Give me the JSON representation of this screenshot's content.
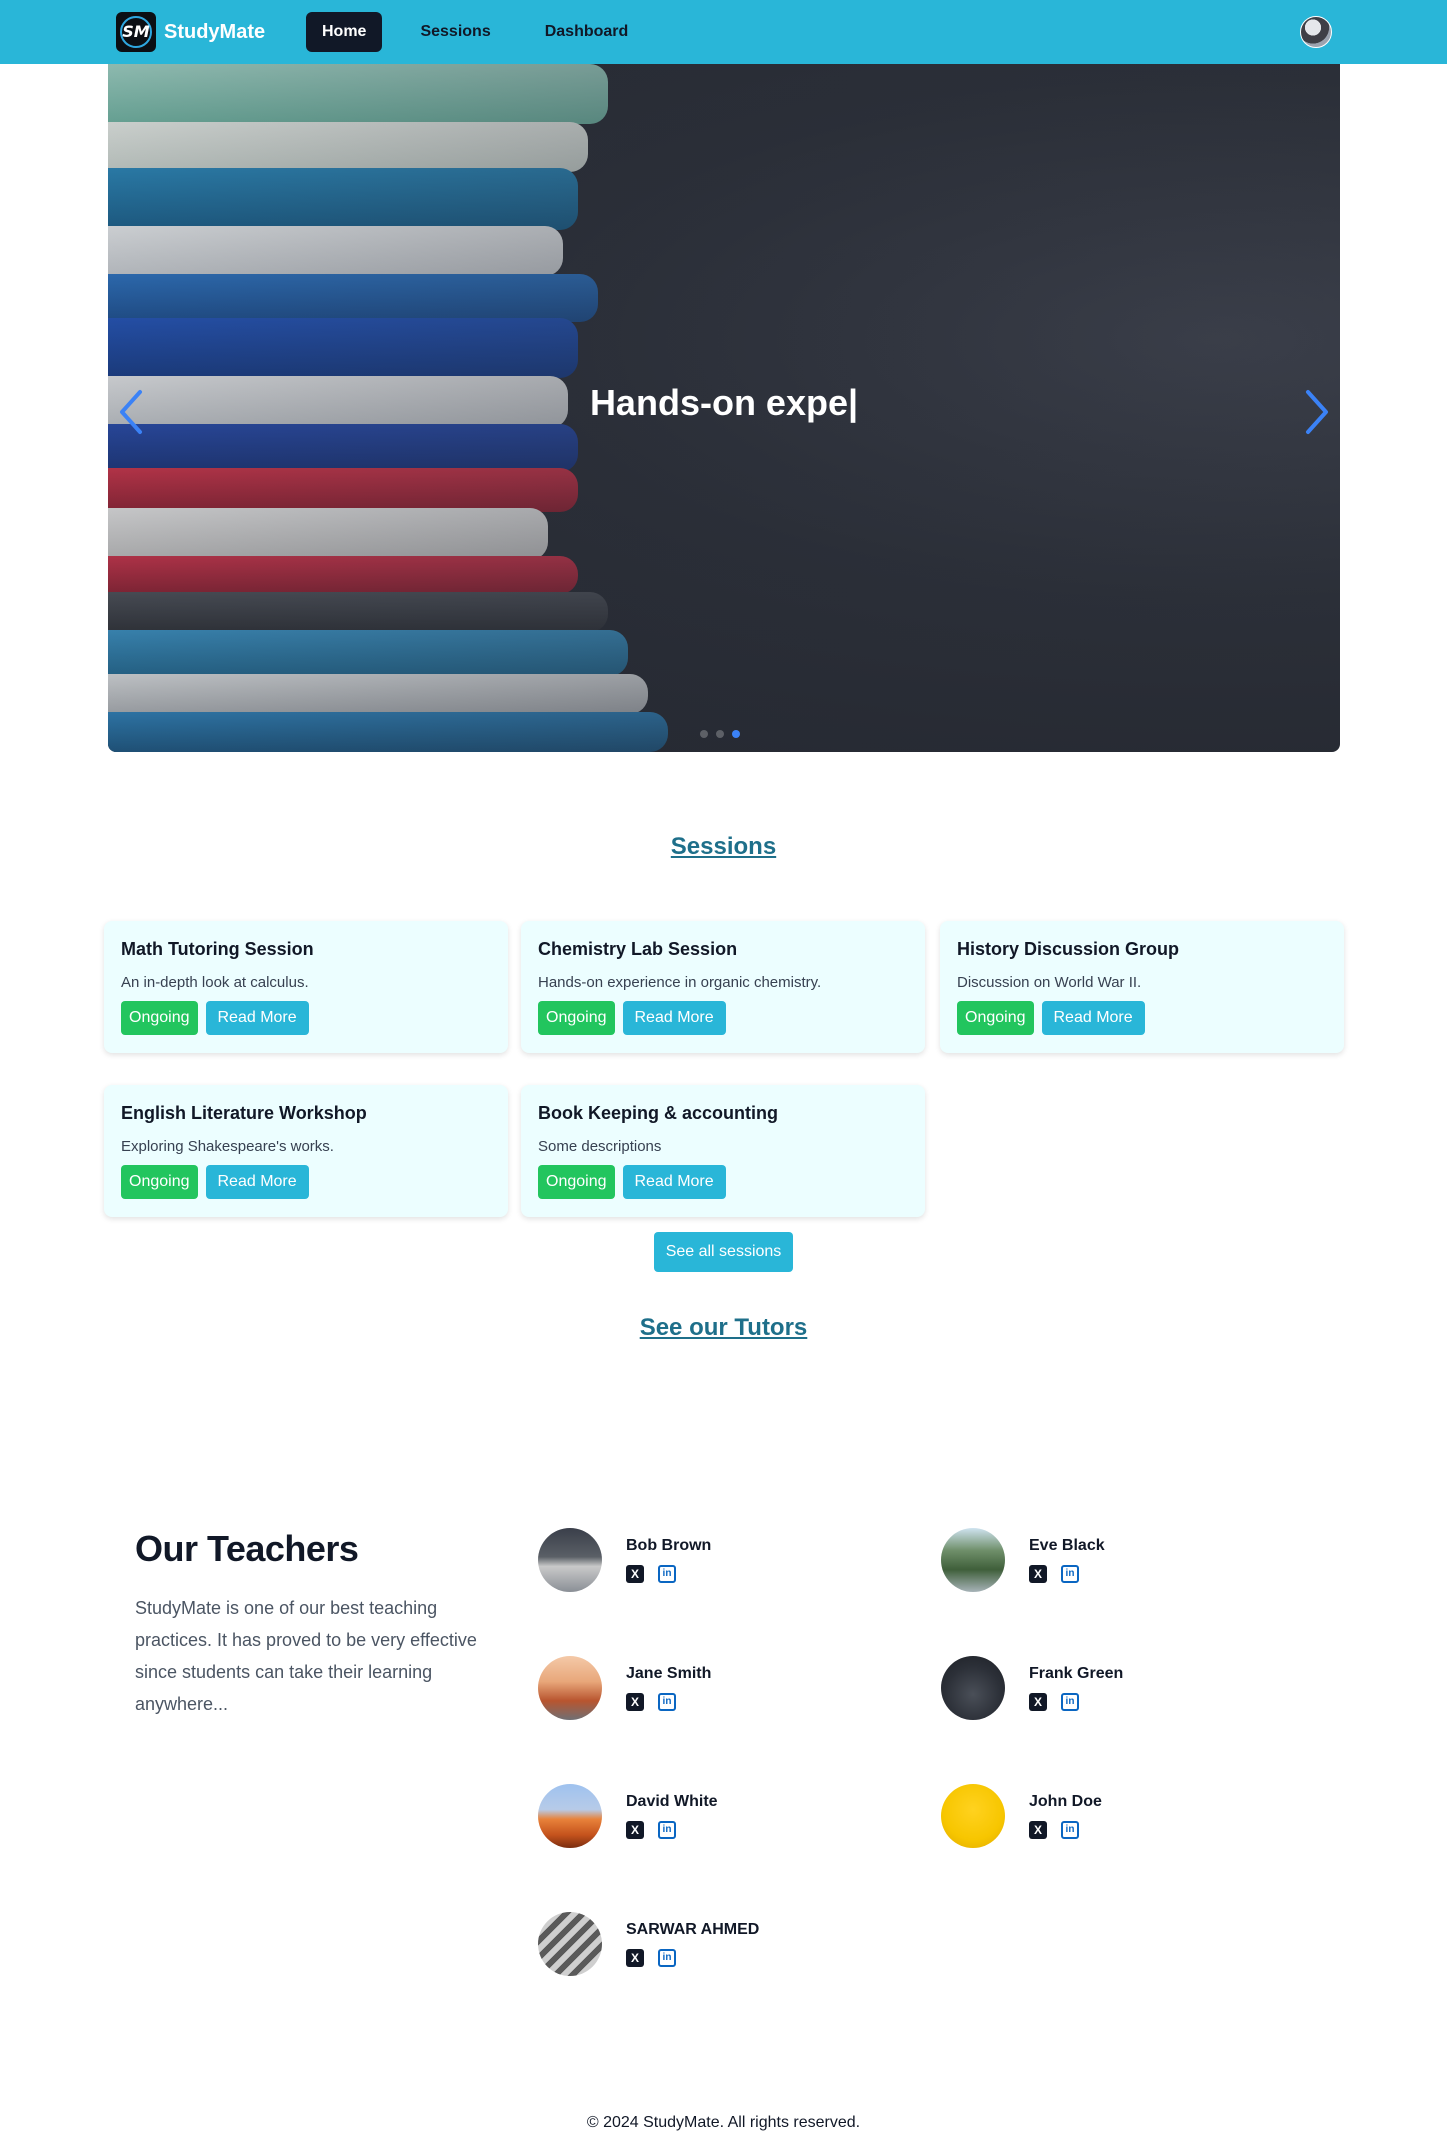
{
  "brand": {
    "logo_text": "SM",
    "name": "StudyMate"
  },
  "nav": {
    "links": [
      {
        "label": "Home",
        "active": true
      },
      {
        "label": "Sessions",
        "active": false
      },
      {
        "label": "Dashboard",
        "active": false
      }
    ]
  },
  "hero": {
    "text": "Hands-on expe|",
    "slide_count": 3,
    "active_slide": 3
  },
  "sessions": {
    "title": "Sessions",
    "items": [
      {
        "title": "Math Tutoring Session",
        "description": "An in-depth look at calculus.",
        "status": "Ongoing",
        "action": "Read More"
      },
      {
        "title": "Chemistry Lab Session",
        "description": "Hands-on experience in organic chemistry.",
        "status": "Ongoing",
        "action": "Read More"
      },
      {
        "title": "History Discussion Group",
        "description": "Discussion on World War II.",
        "status": "Ongoing",
        "action": "Read More"
      },
      {
        "title": "English Literature Workshop",
        "description": "Exploring Shakespeare's works.",
        "status": "Ongoing",
        "action": "Read More"
      },
      {
        "title": "Book Keeping & accounting",
        "description": "Some descriptions",
        "status": "Ongoing",
        "action": "Read More"
      }
    ],
    "see_all": "See all sessions"
  },
  "tutors_link": "See our Tutors",
  "teachers": {
    "heading": "Our Teachers",
    "description": "StudyMate is one of our best teaching practices. It has proved to be very effective since students can take their learning anywhere...",
    "list": [
      {
        "name": "Bob Brown"
      },
      {
        "name": "Eve Black"
      },
      {
        "name": "Jane Smith"
      },
      {
        "name": "Frank Green"
      },
      {
        "name": "David White"
      },
      {
        "name": "John Doe"
      },
      {
        "name": "SARWAR AHMED"
      }
    ],
    "social_icons": {
      "x": "X",
      "linkedin": "in"
    }
  },
  "footer": {
    "text": "© 2024 StudyMate. All rights reserved."
  },
  "colors": {
    "navbar": "#29b6d8",
    "accent": "#29b6d8",
    "status_green": "#22c55e",
    "section_title": "#1e6f8a",
    "card_bg": "#ecfeff",
    "carousel_arrow": "#3b82f6"
  }
}
